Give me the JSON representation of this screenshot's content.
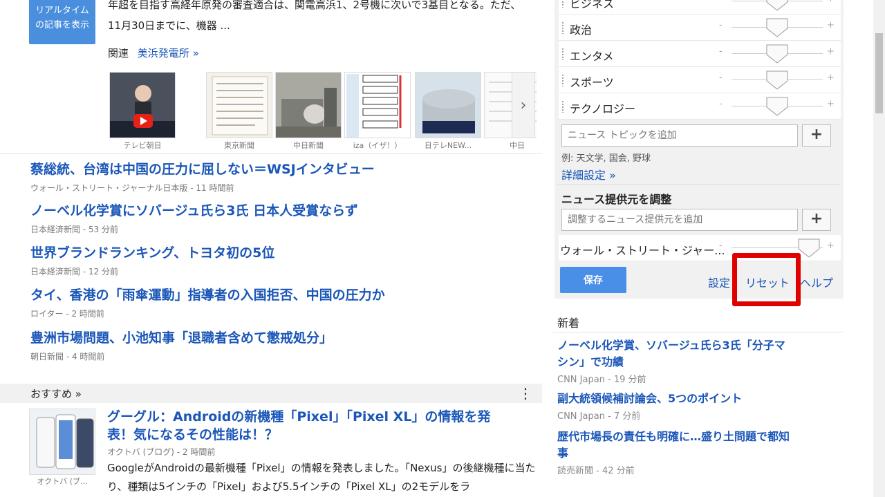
{
  "top_story": {
    "realtime_button": "リアルタイムの記事を表示",
    "snippet": "年超を目指す高経年原発の審査適合は、関電高浜1、2号機に次いで3基目となる。ただ、11月30日までに、機器 ...",
    "related_label": "関連",
    "related_link": "美浜発電所 »",
    "thumbnails": [
      {
        "caption": "テレビ朝日"
      },
      {
        "caption": "東京新聞"
      },
      {
        "caption": "中日新聞"
      },
      {
        "caption": "iza（イザ！）"
      },
      {
        "caption": "日テレNEW..."
      },
      {
        "caption": "中日"
      }
    ],
    "next_arrow": "›"
  },
  "stories": [
    {
      "title": "蔡総統、台湾は中国の圧力に屈しない＝WSJインタビュー",
      "meta": "ウォール・ストリート・ジャーナル日本版 - 11 時間前"
    },
    {
      "title": "ノーベル化学賞にソバージュ氏ら3氏 日本人受賞ならず",
      "meta": "日本経済新聞 - 53 分前"
    },
    {
      "title": "世界ブランドランキング、トヨタ初の5位",
      "meta": "日本経済新聞 - 12 分前"
    },
    {
      "title": "タイ、香港の「雨傘運動」指導者の入国拒否、中国の圧力か",
      "meta": "ロイター - 2 時間前"
    },
    {
      "title": "豊洲市場問題、小池知事「退職者含めて懲戒処分」",
      "meta": "朝日新聞 - 4 時間前"
    }
  ],
  "recommend": {
    "label": "おすすめ »",
    "menu_icon": "⋮",
    "image_caption": "オクトバ (ブ...",
    "title": "グーグル：Androidの新機種「Pixel」「Pixel XL」の情報を発表！気になるその性能は！？",
    "meta": "オクトバ (ブログ) - 2 時間前",
    "body": "GoogleがAndroidの最新機種「Pixel」の情報を発表しました。「Nexus」の後継機種に当たり、種類は5インチの「Pixel」および5.5インチの「Pixel XL」の2モデルをラ"
  },
  "panel": {
    "sliders": [
      {
        "label": "ビジネス",
        "level": 0.5
      },
      {
        "label": "政治",
        "level": 0.5
      },
      {
        "label": "エンタメ",
        "level": 0.5
      },
      {
        "label": "スポーツ",
        "level": 0.5
      },
      {
        "label": "テクノロジー",
        "level": 0.5
      }
    ],
    "minus": "-",
    "plus": "+",
    "topic_placeholder": "ニュース トピックを追加",
    "add_symbol": "+",
    "example": "例: 天文学, 国会, 野球",
    "advanced": "詳細設定 »",
    "source_heading": "ニュース提供元を調整",
    "source_placeholder": "調整するニュース提供元を追加",
    "source_slider": {
      "label": "ウォール・ストリート・ジャー...",
      "level": 0.85
    },
    "save": "保存",
    "settings": "設定",
    "reset": "リセット",
    "help": "ヘルプ",
    "highlight_color": "#e00000"
  },
  "new_section": {
    "heading": "新着",
    "items": [
      {
        "title": "ノーベル化学賞、ソバージュ氏ら3氏「分子マシン」で功績",
        "meta": "CNN Japan - 19 分前"
      },
      {
        "title": "副大統領候補討論会、5つのポイント",
        "meta": "CNN Japan - 7 分前"
      },
      {
        "title": "歴代市場長の責任も明確に…盛り土問題で都知事",
        "meta": "読売新聞 - 42 分前"
      }
    ]
  },
  "colors": {
    "link": "#1a56b8",
    "accent": "#4a8fe7"
  }
}
